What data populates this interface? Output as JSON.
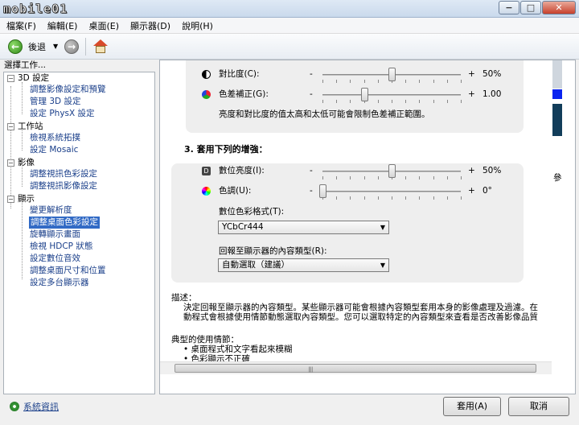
{
  "window": {
    "logo_text": "mobile01",
    "controls": {
      "minimize": "−",
      "maximize": "□",
      "close": "✕"
    }
  },
  "menu": [
    "檔案(F)",
    "編輯(E)",
    "桌面(E)",
    "顯示器(D)",
    "說明(H)"
  ],
  "toolbar": {
    "back_label": "後退",
    "dropdown_glyph": "▼",
    "back_glyph": "←",
    "forward_glyph": "→"
  },
  "left_pane": {
    "header": "選擇工作...",
    "tree": [
      {
        "label": "3D 設定",
        "children": [
          "調整影像設定和預覽",
          "管理 3D 設定",
          "設定 PhysX 設定"
        ]
      },
      {
        "label": "工作站",
        "children": [
          "檢視系統拓撲",
          "設定 Mosaic"
        ]
      },
      {
        "label": "影像",
        "children": [
          "調整視訊色彩設定",
          "調整視訊影像設定"
        ]
      },
      {
        "label": "顯示",
        "children": [
          "變更解析度",
          "調整桌面色彩設定",
          "旋轉顯示畫面",
          "檢視 HDCP 狀態",
          "設定數位音效",
          "調整桌面尺寸和位置",
          "設定多台顯示器"
        ]
      }
    ],
    "selected": "調整桌面色彩設定",
    "system_info": "系統資訊"
  },
  "adjustments": {
    "contrast": {
      "label": "對比度(C):",
      "minus": "-",
      "plus": "+",
      "value": "50%",
      "level": 0.5
    },
    "gamma": {
      "label": "色差補正(G):",
      "minus": "-",
      "plus": "+",
      "value": "1.00",
      "level": 0.3
    },
    "warning": "亮度和對比度的值太高和太低可能會限制色差補正範圍。",
    "section3_title": "3. 套用下列的增強：",
    "digital_vibrance": {
      "label": "數位亮度(I):",
      "minus": "-",
      "plus": "+",
      "value": "50%",
      "level": 0.5
    },
    "hue": {
      "label": "色調(U):",
      "minus": "-",
      "plus": "+",
      "value": "0°",
      "level": 0.0
    },
    "color_format_label": "數位色彩格式(T):",
    "color_format_value": "YCbCr444",
    "content_type_label": "回報至顯示器的內容類型(R):",
    "content_type_value": "自動選取（建議）"
  },
  "description": {
    "heading": "描述：",
    "line1": "決定回報至顯示器的內容類型。某些顯示器可能會根據內容類型套用本身的影像處理及過濾。在",
    "line2": "動程式會根據使用情節動態選取內容類型。您可以選取特定的內容類型來查看是否改善影像品質",
    "usage_heading": "典型的使用情節：",
    "usage1": "• 桌面程式和文字看起來模糊",
    "usage2": "• 色彩顯示不正確"
  },
  "side_char": "參",
  "buttons": {
    "apply": "套用(A)",
    "cancel": "取消"
  }
}
